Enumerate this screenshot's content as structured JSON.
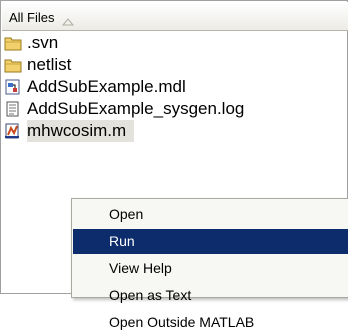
{
  "header": {
    "title": "All Files",
    "sort_icon": "sort-ascending-icon"
  },
  "files": [
    {
      "name": ".svn",
      "icon": "folder-icon"
    },
    {
      "name": "netlist",
      "icon": "folder-icon"
    },
    {
      "name": "AddSubExample.mdl",
      "icon": "simulink-model-icon"
    },
    {
      "name": "AddSubExample_sysgen.log",
      "icon": "text-file-icon"
    },
    {
      "name": "mhwcosim.m",
      "icon": "matlab-script-icon"
    }
  ],
  "context_menu": {
    "items": [
      {
        "label": "Open"
      },
      {
        "label": "Run"
      },
      {
        "label": "View Help"
      },
      {
        "label": "Open as Text"
      },
      {
        "label": "Open Outside MATLAB"
      }
    ],
    "highlighted_index": 1
  },
  "colors": {
    "highlight": "#0c2c6c",
    "selection": "#e3e2dc",
    "folder": "#f2d06b"
  }
}
